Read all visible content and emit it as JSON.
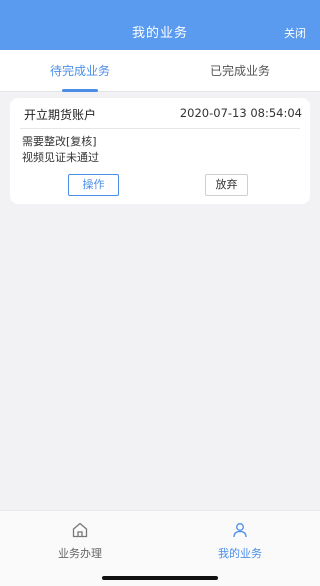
{
  "header": {
    "title": "我的业务",
    "close_label": "关闭"
  },
  "tabs": [
    {
      "label": "待完成业务",
      "active": true
    },
    {
      "label": "已完成业务",
      "active": false
    }
  ],
  "card": {
    "business_name": "开立期货账户",
    "timestamp": "2020-07-13 08:54:04",
    "status_line1": "需要整改[复核]",
    "status_line2": "视频见证未通过",
    "action_button": "操作",
    "abandon_button": "放弃"
  },
  "bottom_nav": [
    {
      "label": "业务办理",
      "icon": "home-icon",
      "active": false
    },
    {
      "label": "我的业务",
      "icon": "person-icon",
      "active": true
    }
  ],
  "colors": {
    "accent": "#4b8ee8",
    "header_bg": "#5a9bf0"
  }
}
